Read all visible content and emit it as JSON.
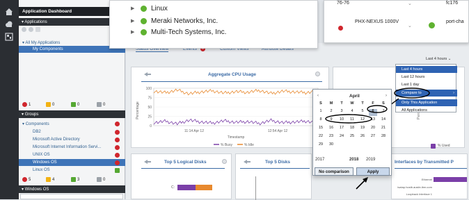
{
  "sidebar": {
    "title": "Application Dashboard",
    "applications_header": "Applications",
    "all_apps": "All My Applications",
    "my_components": "My Components",
    "status_counts": [
      "1",
      "0",
      "0",
      "0"
    ],
    "groups_header": "Groups",
    "components_label": "Components",
    "items": [
      {
        "label": "DB2",
        "status": "red"
      },
      {
        "label": "Microsoft Active Directory",
        "status": "red"
      },
      {
        "label": "Microsoft Internet Information Servi...",
        "status": "red"
      },
      {
        "label": "UNIX OS",
        "status": "red"
      },
      {
        "label": "Windows OS",
        "status": "red"
      },
      {
        "label": "Linux OS",
        "status": "green"
      }
    ],
    "group_counts": [
      "5",
      "4",
      "3",
      "0"
    ],
    "windows_os_header": "Windows OS"
  },
  "popup": {
    "items": [
      "Linux",
      "Meraki Networks, Inc.",
      "Multi-Tech Systems, Inc."
    ]
  },
  "popup2": {
    "row1_left": "76-76",
    "row1_right": "fc176",
    "row2_left": "PHX-NEXUS 1000V",
    "row2_right": "port-cha"
  },
  "tabs": [
    "Status Overview",
    "Events",
    "Custom Views",
    "Attribute Details"
  ],
  "events_badge": "5",
  "time_select": "Last 4 hours",
  "cpu": {
    "title": "Aggregate CPU Usage",
    "ylabel": "Percentage",
    "xlabel": "Timestamp",
    "yticks": [
      "100",
      "75",
      "50",
      "25",
      "0"
    ],
    "xticks": [
      "11:14 Apr 12",
      "12:54 Apr 12"
    ],
    "legend": [
      "% Busy",
      "% Idle"
    ]
  },
  "disks_title": "Top 5 Logical Disks",
  "disks2_title": "Top 5 Disks",
  "interfaces_title": "Interfaces by Transmitted P",
  "perce_label": "Perce",
  "used_label": "% Used",
  "iface_rows": [
    "Ethernet",
    "isatap.hostb.austin.ibm.com",
    "Loopback Interface 1"
  ],
  "disk_row": "C:",
  "menu": {
    "items": [
      "Last 4 hours",
      "Last 12 hours",
      "Last 1 day",
      "Compare to",
      "Only This Application",
      "All Applications"
    ]
  },
  "calendar": {
    "month": "April",
    "weekdays": [
      "S",
      "M",
      "T",
      "W",
      "T",
      "F",
      "S"
    ],
    "days": [
      "1",
      "2",
      "3",
      "4",
      "5",
      "6",
      "7",
      "8",
      "9",
      "10",
      "11",
      "12",
      "13",
      "14",
      "15",
      "16",
      "17",
      "18",
      "19",
      "20",
      "21",
      "22",
      "23",
      "24",
      "25",
      "26",
      "27",
      "28",
      "29",
      "30"
    ],
    "years": [
      "2017",
      "2018",
      "2019"
    ],
    "no_comparison": "No comparison",
    "apply": "Apply"
  },
  "chart_data": {
    "type": "line",
    "title": "Aggregate CPU Usage",
    "xlabel": "Timestamp",
    "ylabel": "Percentage",
    "ylim": [
      0,
      100
    ],
    "series": [
      {
        "name": "% Idle",
        "values": [
          92,
          88,
          95,
          85,
          90,
          93,
          87,
          91,
          89,
          94,
          86,
          92,
          90,
          88,
          93
        ]
      },
      {
        "name": "% Busy",
        "values": [
          8,
          12,
          5,
          15,
          10,
          7,
          13,
          9,
          11,
          6,
          14,
          8,
          10,
          12,
          7
        ]
      }
    ],
    "colors": {
      "busy": "#7b3fa8",
      "idle": "#e8892e"
    }
  }
}
